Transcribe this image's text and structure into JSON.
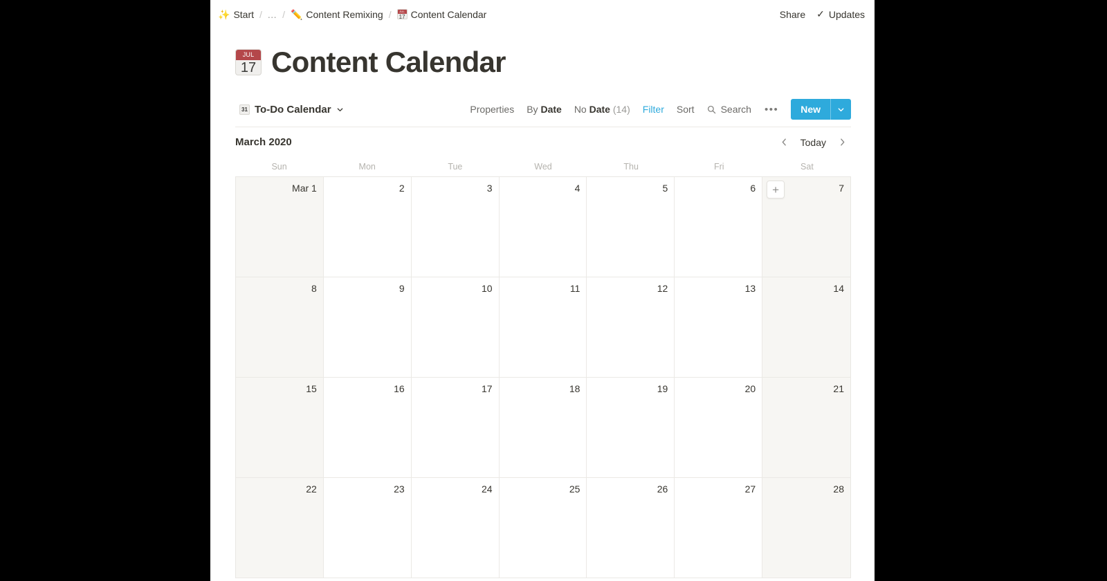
{
  "breadcrumb": {
    "items": [
      {
        "icon": "sparkles-emoji",
        "glyph": "✨",
        "label": "Start"
      },
      {
        "icon": "ellipsis",
        "glyph": "",
        "label": "..."
      },
      {
        "icon": "pencil-emoji",
        "glyph": "✏️",
        "label": "Content Remixing"
      },
      {
        "icon": "calendar-emoji",
        "glyph": "",
        "label": "Content Calendar"
      }
    ],
    "separator": "/"
  },
  "topbar": {
    "share_label": "Share",
    "updates_label": "Updates",
    "check_glyph": "✓"
  },
  "page": {
    "icon_month": "JUL",
    "icon_day": "17",
    "title": "Content Calendar"
  },
  "toolbar": {
    "view_icon_day": "31",
    "view_name": "To-Do Calendar",
    "view_caret": "⌄",
    "properties_label": "Properties",
    "group_prefix": "By",
    "group_value": "Date",
    "nodate_prefix": "No",
    "nodate_value": "Date",
    "nodate_count": "(14)",
    "filter_label": "Filter",
    "filter_color": "#2eaadc",
    "sort_label": "Sort",
    "search_label": "Search",
    "more_label": "•••",
    "new_label": "New",
    "new_bg": "#2eaadc"
  },
  "calendar": {
    "month_label": "March 2020",
    "today_label": "Today",
    "prev_glyph": "‹",
    "next_glyph": "›",
    "weekdays": [
      "Sun",
      "Mon",
      "Tue",
      "Wed",
      "Thu",
      "Fri",
      "Sat"
    ],
    "weekend_bg": "#f7f6f3",
    "add_glyph": "+",
    "add_cell_index": 6,
    "cells": [
      {
        "label": "Mar 1",
        "weekend": true
      },
      {
        "label": "2",
        "weekend": false
      },
      {
        "label": "3",
        "weekend": false
      },
      {
        "label": "4",
        "weekend": false
      },
      {
        "label": "5",
        "weekend": false
      },
      {
        "label": "6",
        "weekend": false
      },
      {
        "label": "7",
        "weekend": true
      },
      {
        "label": "8",
        "weekend": true
      },
      {
        "label": "9",
        "weekend": false
      },
      {
        "label": "10",
        "weekend": false
      },
      {
        "label": "11",
        "weekend": false
      },
      {
        "label": "12",
        "weekend": false
      },
      {
        "label": "13",
        "weekend": false
      },
      {
        "label": "14",
        "weekend": true
      },
      {
        "label": "15",
        "weekend": true
      },
      {
        "label": "16",
        "weekend": false
      },
      {
        "label": "17",
        "weekend": false
      },
      {
        "label": "18",
        "weekend": false
      },
      {
        "label": "19",
        "weekend": false
      },
      {
        "label": "20",
        "weekend": false
      },
      {
        "label": "21",
        "weekend": true
      },
      {
        "label": "22",
        "weekend": true
      },
      {
        "label": "23",
        "weekend": false
      },
      {
        "label": "24",
        "weekend": false
      },
      {
        "label": "25",
        "weekend": false
      },
      {
        "label": "26",
        "weekend": false
      },
      {
        "label": "27",
        "weekend": false
      },
      {
        "label": "28",
        "weekend": true
      }
    ]
  }
}
